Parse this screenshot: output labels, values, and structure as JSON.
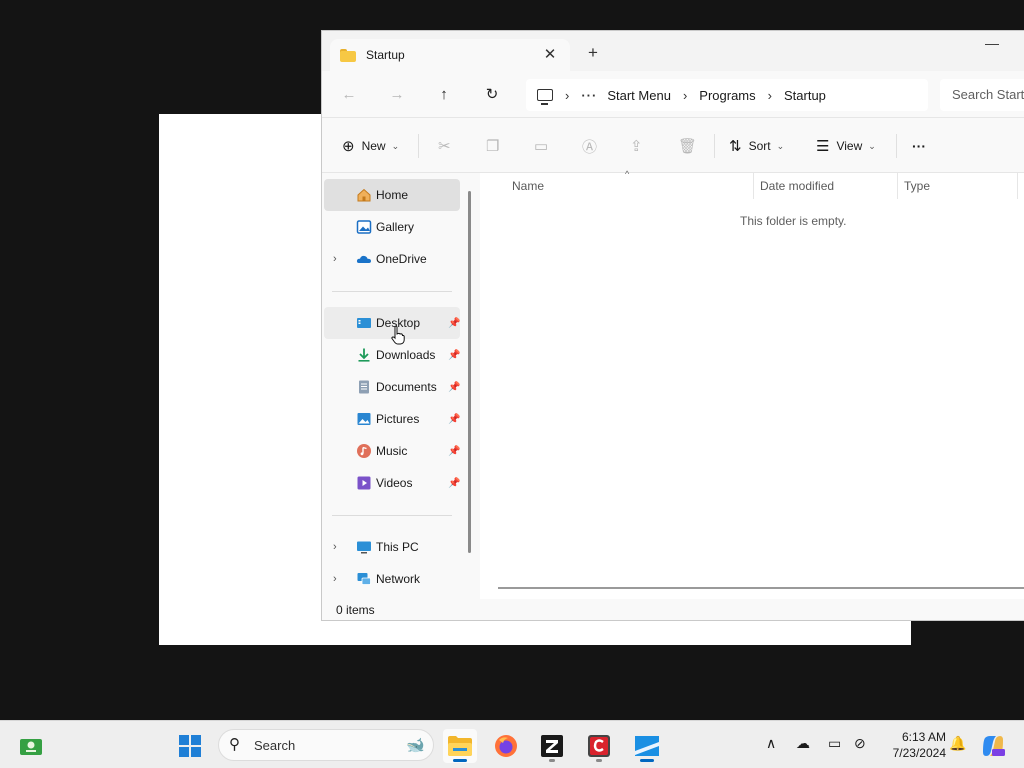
{
  "window": {
    "tab_title": "Startup",
    "tab_close": "✕",
    "new_tab": "+",
    "minimize": "—"
  },
  "navbar": {
    "back": "←",
    "forward": "→",
    "up": "↑",
    "refresh": "↻",
    "breadcrumb_more": "···",
    "breadcrumbs": [
      "Start Menu",
      "Programs",
      "Startup"
    ],
    "search_placeholder": "Search Startup"
  },
  "commands": {
    "new_label": "New",
    "sort_label": "Sort",
    "view_label": "View",
    "more": "···"
  },
  "nav_pane": {
    "quick": [
      {
        "label": "Home",
        "icon": "home-icon"
      },
      {
        "label": "Gallery",
        "icon": "gallery-icon"
      },
      {
        "label": "OneDrive",
        "icon": "onedrive-icon"
      }
    ],
    "pinned": [
      {
        "label": "Desktop",
        "icon": "desktop-icon"
      },
      {
        "label": "Downloads",
        "icon": "downloads-icon"
      },
      {
        "label": "Documents",
        "icon": "documents-icon"
      },
      {
        "label": "Pictures",
        "icon": "pictures-icon"
      },
      {
        "label": "Music",
        "icon": "music-icon"
      },
      {
        "label": "Videos",
        "icon": "videos-icon"
      }
    ],
    "locations": [
      {
        "label": "This PC",
        "icon": "this-pc-icon"
      },
      {
        "label": "Network",
        "icon": "network-icon"
      }
    ]
  },
  "content": {
    "columns": [
      "Name",
      "Date modified",
      "Type"
    ],
    "empty_message": "This folder is empty."
  },
  "status": {
    "items_count": "0 items"
  },
  "taskbar": {
    "search_label": "Search",
    "time": "6:13 AM",
    "date": "7/23/2024"
  },
  "colors": {
    "accent": "#0067c0",
    "folder": "#f7c844"
  }
}
